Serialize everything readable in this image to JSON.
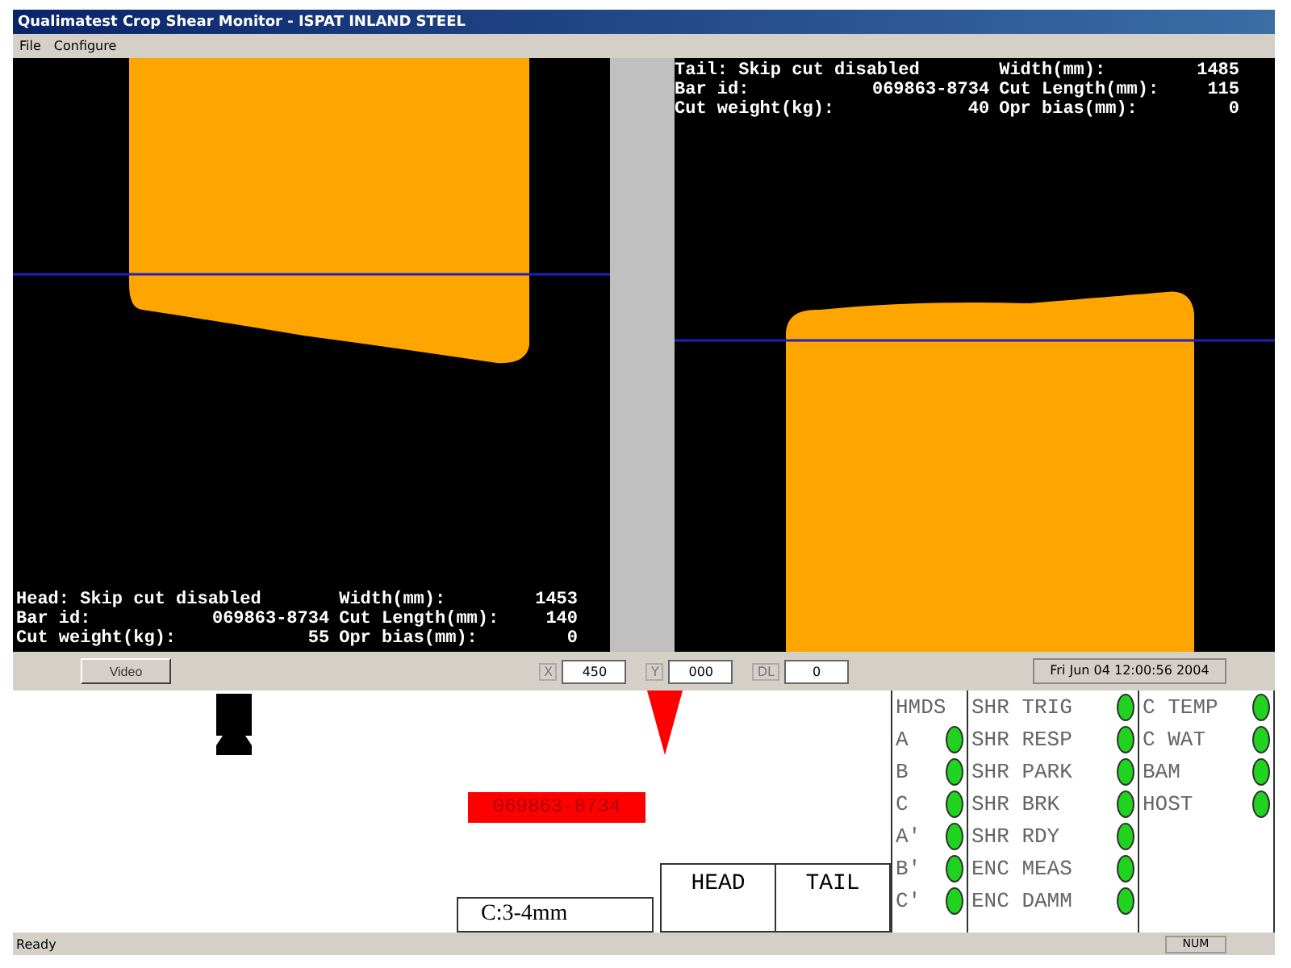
{
  "window": {
    "title": "Qualimatest Crop Shear Monitor - ISPAT INLAND STEEL"
  },
  "menu": [
    "File",
    "Configure"
  ],
  "views": [
    {
      "kind": "head",
      "readout": {
        "title": "Head: Skip cut disabled",
        "rows": [
          {
            "label": "Width(mm):",
            "value": "1453"
          },
          {
            "label": "Bar id:",
            "value": "069863-8734"
          },
          {
            "label": "Cut Length(mm):",
            "value": "140"
          },
          {
            "label": "Cut weight(kg):",
            "value": "55"
          },
          {
            "label": "Opr bias(mm):",
            "value": "0"
          }
        ]
      }
    },
    {
      "kind": "tail",
      "readout": {
        "title": "Tail: Skip cut disabled",
        "rows": [
          {
            "label": "Width(mm):",
            "value": "1485"
          },
          {
            "label": "Bar id:",
            "value": "069863-8734"
          },
          {
            "label": "Cut Length(mm):",
            "value": "115"
          },
          {
            "label": "Cut weight(kg):",
            "value": "40"
          },
          {
            "label": "Opr bias(mm):",
            "value": "0"
          }
        ]
      }
    }
  ],
  "toolbar": {
    "video_button": "Video",
    "fields": [
      {
        "label": "X",
        "value": "450"
      },
      {
        "label": "Y",
        "value": "000"
      },
      {
        "label": "DL",
        "value": "0"
      }
    ],
    "datetime": "Fri Jun 04 12:00:56 2004"
  },
  "strip": {
    "bar_id": "069863-8734",
    "clearance": "C:3-4mm",
    "ends": [
      {
        "label": "HEAD",
        "selected": false
      },
      {
        "label": "TAIL",
        "selected": false
      }
    ]
  },
  "indicators": [
    {
      "header": "HMDS",
      "items": [
        {
          "label": "A",
          "on": true
        },
        {
          "label": "B",
          "on": true
        },
        {
          "label": "C",
          "on": true
        },
        {
          "label": "A'",
          "on": true
        },
        {
          "label": "B'",
          "on": true
        },
        {
          "label": "C'",
          "on": true
        }
      ]
    },
    {
      "items": [
        {
          "label": "SHR TRIG",
          "on": true
        },
        {
          "label": "SHR RESP",
          "on": true
        },
        {
          "label": "SHR PARK",
          "on": true
        },
        {
          "label": "SHR BRK",
          "on": true
        },
        {
          "label": "SHR RDY",
          "on": true
        },
        {
          "label": "ENC MEAS",
          "on": true
        },
        {
          "label": "ENC DAMM",
          "on": true
        }
      ]
    },
    {
      "items": [
        {
          "label": "C TEMP",
          "on": true
        },
        {
          "label": "C WAT",
          "on": true
        },
        {
          "label": "BAM",
          "on": true
        },
        {
          "label": "HOST",
          "on": true
        }
      ]
    }
  ],
  "status_bar": {
    "message": "Ready",
    "indicator": "NUM"
  }
}
